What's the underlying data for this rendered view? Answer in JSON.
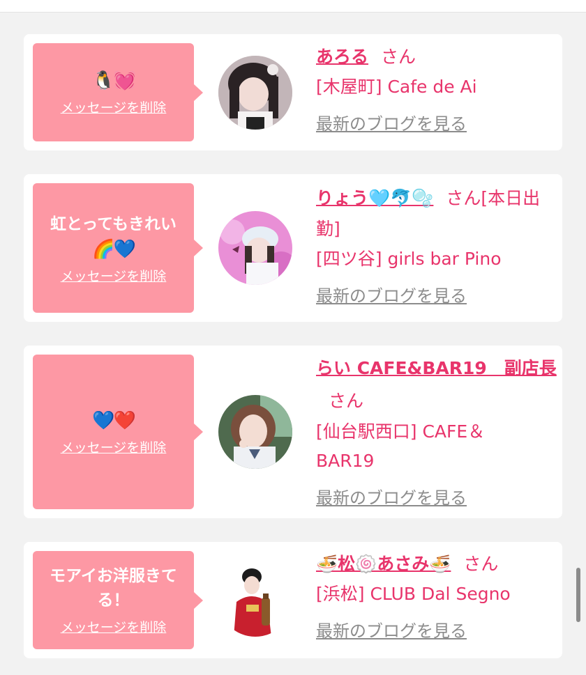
{
  "colors": {
    "page_bg": "#f2f2f2",
    "card_bg": "#ffffff",
    "bubble_bg": "#fd98a4",
    "accent": "#e8346b",
    "link_gray": "#8c8c8c"
  },
  "cards": [
    {
      "message": "",
      "emoji": "🐧💓",
      "delete_label": "メッセージを削除",
      "name": "あろる",
      "san_suffix": "さん",
      "shop": "[木屋町] Cafe de Ai",
      "blog_label": "最新のブログを見る"
    },
    {
      "message": "虹とってもきれい",
      "emoji": "🌈💙",
      "delete_label": "メッセージを削除",
      "name": "りょう🩵🐬🫧",
      "san_suffix": "さん[本日出勤]",
      "shop": "[四ツ谷] girls bar Pino",
      "blog_label": "最新のブログを見る"
    },
    {
      "message": "",
      "emoji": "💙❤️",
      "delete_label": "メッセージを削除",
      "name": "らい CAFE&BAR19　副店長",
      "san_suffix": "さん",
      "shop": "[仙台駅西口] CAFE＆BAR19",
      "blog_label": "最新のブログを見る"
    },
    {
      "message": "モアイお洋服きてる！",
      "emoji": "",
      "delete_label": "メッセージを削除",
      "name": "🍜松🍥あさみ🍜",
      "san_suffix": "さん",
      "shop": "[浜松] CLUB Dal Segno",
      "blog_label": "最新のブログを見る"
    }
  ]
}
